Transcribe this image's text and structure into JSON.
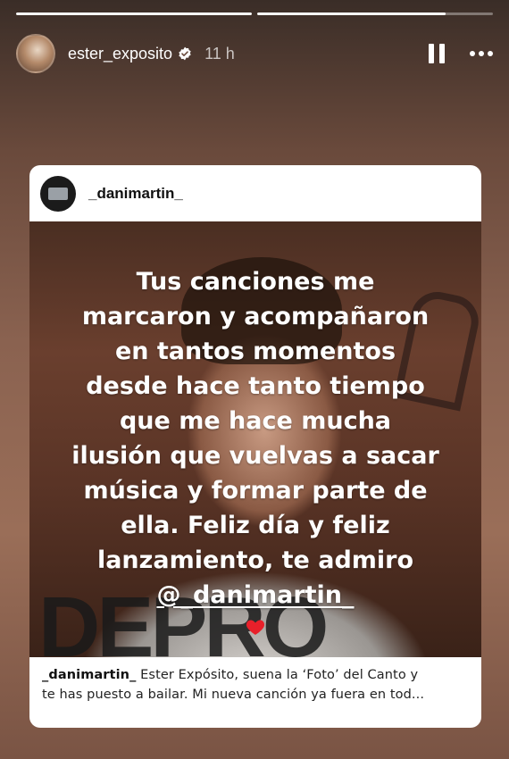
{
  "story": {
    "progress": [
      1.0,
      0.8
    ],
    "username": "ester_exposito",
    "verified": true,
    "time": "11 h"
  },
  "post": {
    "username": "_danimartin_",
    "text_lines": [
      "Tus canciones me",
      "marcaron y acompañaron",
      "en tantos momentos",
      "desde hace tanto tiempo",
      "que me hace mucha",
      "ilusión que vuelvas a sacar",
      "música y formar parte de",
      "ella. Feliz día y feliz",
      "lanzamiento, te admiro"
    ],
    "mention": "@_danimartin_",
    "sweater_text": "DEPRO",
    "caption_user": "_danimartin_",
    "caption_line1": " Ester Expósito, suena la ‘Foto’ del Canto y",
    "caption_line2": "te has puesto a bailar. Mi nueva canción ya fuera en tod..."
  },
  "colors": {
    "heart": "#e8202a",
    "verified_badge": "#ffffff"
  },
  "icons": [
    "verified-icon",
    "pause-icon",
    "more-icon",
    "heart-icon"
  ]
}
